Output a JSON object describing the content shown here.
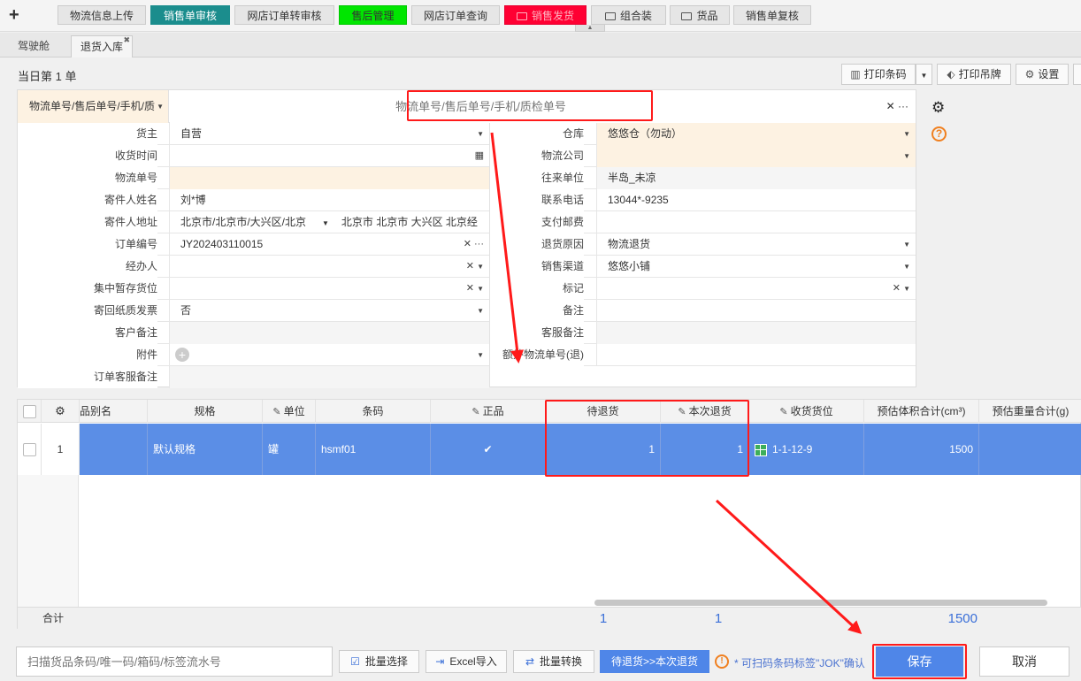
{
  "top_tabs": [
    {
      "label": "物流信息上传",
      "style": "default"
    },
    {
      "label": "销售单审核",
      "style": "teal"
    },
    {
      "label": "网店订单转审核",
      "style": "default"
    },
    {
      "label": "售后管理",
      "style": "green"
    },
    {
      "label": "网店订单查询",
      "style": "default"
    },
    {
      "label": "销售发货",
      "style": "red"
    },
    {
      "label": "组合装",
      "style": "folder"
    },
    {
      "label": "货品",
      "style": "folder"
    },
    {
      "label": "销售单复核",
      "style": "default"
    }
  ],
  "sub_tabs": {
    "cockpit": "驾驶舱",
    "return_in": "退货入库"
  },
  "day_label": "当日第 1 单",
  "toolbar": {
    "print_barcode": "打印条码",
    "print_tag": "打印吊牌",
    "settings": "设置"
  },
  "search": {
    "type_label": "物流单号/售后单号/手机/质",
    "placeholder": "物流单号/售后单号/手机/质检单号"
  },
  "form": {
    "owner": {
      "label": "货主",
      "value": "自营"
    },
    "warehouse": {
      "label": "仓库",
      "value": "悠悠仓（勿动）"
    },
    "receive_time": {
      "label": "收货时间",
      "value": ""
    },
    "logistics_company": {
      "label": "物流公司",
      "value": ""
    },
    "tracking_no": {
      "label": "物流单号",
      "value": ""
    },
    "partner": {
      "label": "往来单位",
      "value": "半岛_未凉"
    },
    "sender_name": {
      "label": "寄件人姓名",
      "value": "刘*博"
    },
    "phone": {
      "label": "联系电话",
      "value": "13044*-9235"
    },
    "sender_address": {
      "label": "寄件人地址",
      "region": "北京市/北京市/大兴区/北京",
      "detail": "北京市 北京市 大兴区 北京经"
    },
    "postage": {
      "label": "支付邮费",
      "value": ""
    },
    "order_no": {
      "label": "订单编号",
      "value": "JY202403110015"
    },
    "return_reason": {
      "label": "退货原因",
      "value": "物流退货"
    },
    "handler": {
      "label": "经办人",
      "value": ""
    },
    "sales_channel": {
      "label": "销售渠道",
      "value": "悠悠小铺"
    },
    "temp_location": {
      "label": "集中暂存货位",
      "value": ""
    },
    "mark": {
      "label": "标记",
      "value": ""
    },
    "paper_invoice": {
      "label": "寄回纸质发票",
      "value": "否"
    },
    "remark": {
      "label": "备注",
      "value": ""
    },
    "customer_remark": {
      "label": "客户备注",
      "value": ""
    },
    "cs_remark": {
      "label": "客服备注",
      "value": ""
    },
    "attachment": {
      "label": "附件"
    },
    "extra_tracking": {
      "label": "额外物流单号(退)",
      "value": ""
    },
    "order_cs_remark": {
      "label": "订单客服备注",
      "value": ""
    }
  },
  "grid": {
    "headers": {
      "brand": "品别名",
      "spec": "规格",
      "unit": "单位",
      "barcode": "条码",
      "genuine": "正品",
      "pending": "待退货",
      "this_return": "本次退货",
      "location": "收货货位",
      "volume": "预估体积合计(cm³)",
      "weight": "预估重量合计(g)"
    },
    "rows": [
      {
        "index": "1",
        "spec": "默认规格",
        "unit": "罐",
        "barcode": "hsmf01",
        "genuine": "✔",
        "pending": "1",
        "this_return": "1",
        "location": "1-1-12-9",
        "volume": "1500"
      }
    ],
    "footer": {
      "label": "合计",
      "pending": "1",
      "this_return": "1",
      "volume": "1500"
    }
  },
  "bottom": {
    "scan_placeholder": "扫描货品条码/唯一码/箱码/标签流水号",
    "batch_select": "批量选择",
    "excel_import": "Excel导入",
    "batch_convert": "批量转换",
    "pending_to_return": "待退货>>本次退货",
    "hint": "* 可扫码条码标签\"JOK\"确认",
    "save": "保存",
    "cancel": "取消"
  },
  "colors": {
    "accent": "#4f86e8",
    "annotation": "#ff1a1a",
    "selected_row": "#5b8ee6",
    "warn_field": "#fdf2e2"
  }
}
